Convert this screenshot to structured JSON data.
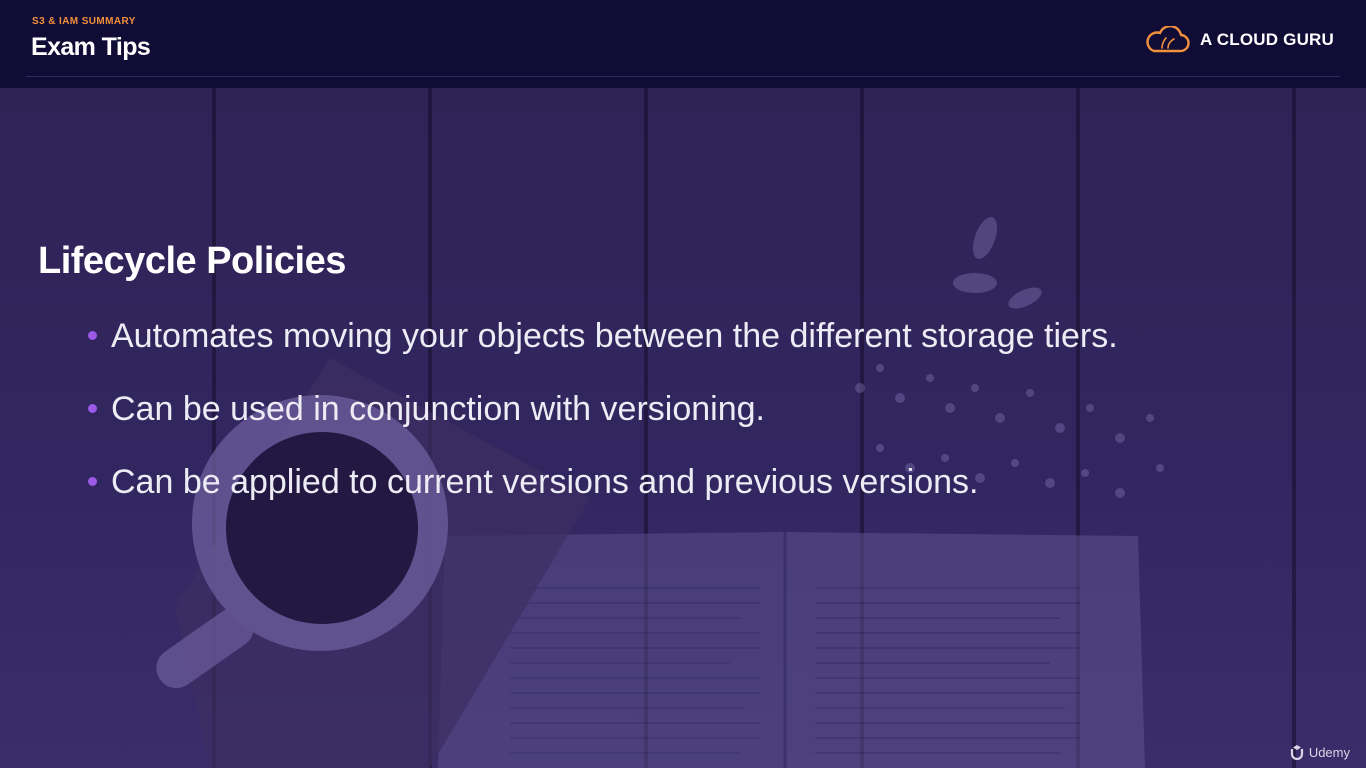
{
  "header": {
    "eyebrow": "S3 & IAM SUMMARY",
    "title": "Exam Tips",
    "brand_name": "A CLOUD GURU",
    "brand_icon": "cloud-logo-icon",
    "brand_color": "#f2913b"
  },
  "content": {
    "heading": "Lifecycle Policies",
    "bullets": [
      "Automates moving your objects between the different storage tiers.",
      "Can be used in conjunction with versioning.",
      "Can be applied to current versions and previous versions."
    ],
    "bullet_color": "#9b5ae6"
  },
  "watermark": {
    "label": "Udemy",
    "icon": "udemy-logo-icon"
  },
  "colors": {
    "header_bg": "#100c36",
    "overlay": "#2a1f4e",
    "accent": "#f2913b"
  }
}
